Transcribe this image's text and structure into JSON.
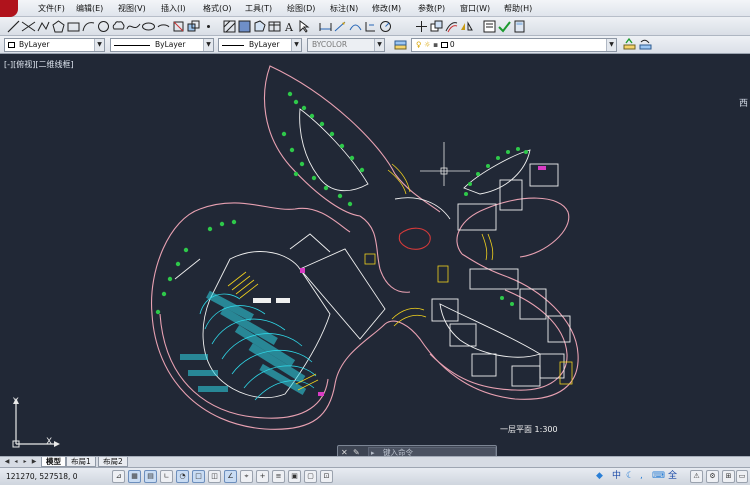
{
  "menu": {
    "items": [
      "文件(F)",
      "编辑(E)",
      "视图(V)",
      "插入(I)",
      "格式(O)",
      "工具(T)",
      "绘图(D)",
      "标注(N)",
      "修改(M)",
      "参数(P)",
      "窗口(W)",
      "帮助(H)"
    ]
  },
  "properties": {
    "layer_color": "ByLayer",
    "linetype": "ByLayer",
    "lineweight": "ByLayer",
    "plot_style": "BYCOLOR",
    "current_layer": "0"
  },
  "viewport": {
    "label": "[-][俯视][二维线框]",
    "compass": "西"
  },
  "drawing": {
    "title": "一层平面 1:300",
    "ucs_x": "X",
    "ucs_y": "Y",
    "colors": {
      "background": "#212836",
      "outline": "#e8a1b2",
      "wall": "#ffffff",
      "seating": "#2fd6e6",
      "planting": "#2ec94a",
      "stair": "#f2d21d",
      "accent": "#d43a3a"
    }
  },
  "command": {
    "prompt": "键入命令",
    "close_icon": "close-icon",
    "settings_icon": "wrench-icon"
  },
  "tabs": {
    "items": [
      "模型",
      "布局1",
      "布局2"
    ],
    "active": "模型"
  },
  "status": {
    "coordinates": "121270, 527518, 0"
  },
  "ime": {
    "lang": "中",
    "mode": "全"
  }
}
